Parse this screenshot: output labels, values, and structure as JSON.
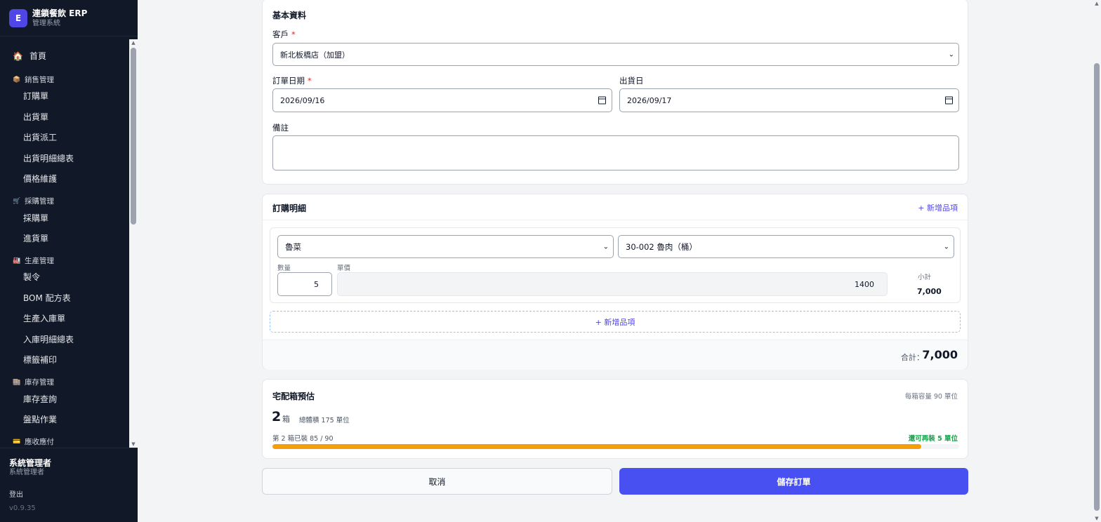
{
  "brand": {
    "logo_letter": "E",
    "title": "連鎖餐飲 ERP",
    "subtitle": "管理系統"
  },
  "nav": {
    "home": "首頁",
    "sales": {
      "label": "銷售管理",
      "items": [
        "訂購單",
        "出貨單",
        "出貨派工",
        "出貨明細總表",
        "價格維護"
      ]
    },
    "purchase": {
      "label": "採購管理",
      "items": [
        "採購單",
        "進貨單"
      ]
    },
    "production": {
      "label": "生產管理",
      "items": [
        "製令",
        "BOM 配方表",
        "生產入庫單",
        "入庫明細總表",
        "標籤補印"
      ]
    },
    "inventory": {
      "label": "庫存管理",
      "items": [
        "庫存查詢",
        "盤點作業"
      ]
    },
    "ar": {
      "label": "應收應付"
    }
  },
  "user": {
    "name": "系統管理者",
    "role": "系統管理者",
    "logout": "登出",
    "version": "v0.9.35"
  },
  "basic": {
    "title": "基本資料",
    "customer_label": "客戶",
    "required_mark": "*",
    "customer_value": "新北板橋店（加盟）",
    "order_date_label": "訂單日期",
    "order_date_value": "2026/09/16",
    "ship_date_label": "出貨日",
    "ship_date_value": "2026/09/17",
    "note_label": "備註",
    "note_value": ""
  },
  "details": {
    "title": "訂購明細",
    "add_item_top": "+ 新增品項",
    "category_value": "魯菜",
    "product_value": "30-002 魯肉（桶）",
    "qty_label": "數量",
    "qty_value": "5",
    "price_label": "單價",
    "price_value": "1400",
    "subtotal_label": "小計",
    "subtotal_value": "7,000",
    "add_item_bottom": "+ 新增品項",
    "total_label": "合計：",
    "total_value": "7,000"
  },
  "boxes": {
    "title": "宅配箱預估",
    "capacity_note": "每箱容量 90 單位",
    "count": "2",
    "unit": "箱",
    "total_volume": "總體積 175 單位",
    "progress_text": "第 2 箱已裝 85 / 90",
    "remaining_text": "還可再裝 5 單位",
    "fill_fraction": 0.9444,
    "colors": {
      "bar": "#f59e0b",
      "remaining": "#16a34a"
    }
  },
  "actions": {
    "cancel": "取消",
    "save": "儲存訂單"
  },
  "colors": {
    "accent": "#4850f2",
    "sidebar": "#111827"
  }
}
